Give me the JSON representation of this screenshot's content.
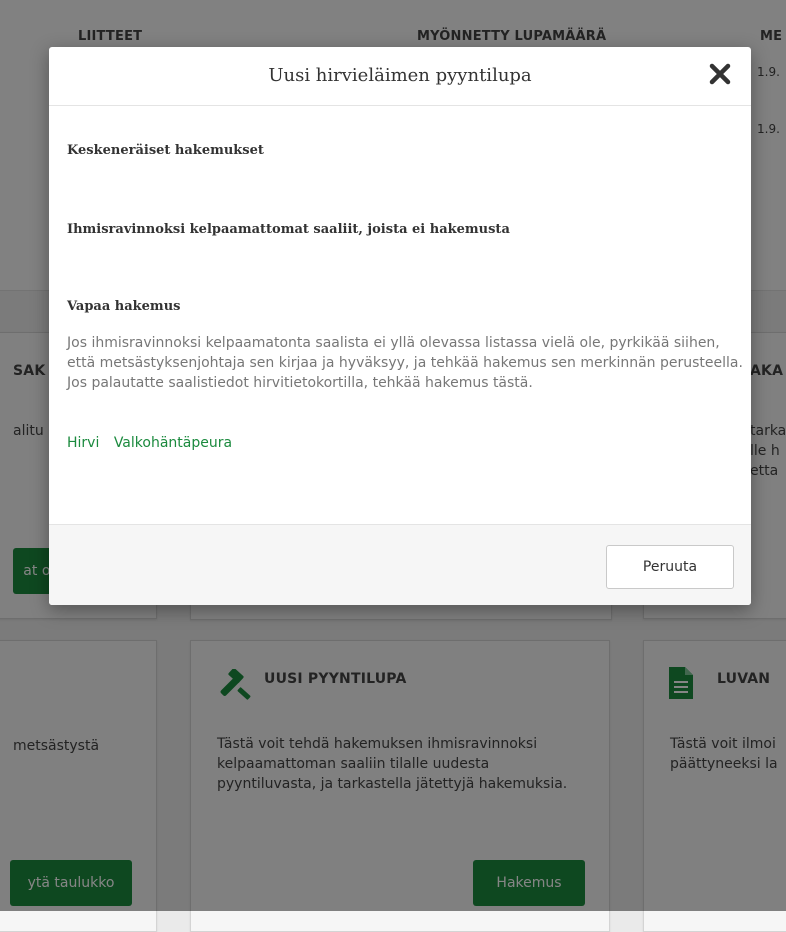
{
  "background": {
    "columns": {
      "attachments": "LIITTEET",
      "granted": "MYÖNNETTY LUPAMÄÄRÄ",
      "third_fragment": "ME"
    },
    "date_fragments": [
      "1.9.",
      "1.9."
    ],
    "left_card": {
      "title_fragment": "SAK",
      "desc_fragment": "alitu",
      "button_fragment": "at os"
    },
    "right_card_top": {
      "title_fragment": "AKA",
      "lines": [
        "tarka",
        "lle h",
        "etta"
      ]
    },
    "bottom_left_card": {
      "desc_fragment": "metsästystä",
      "button_fragment": "ytä taulukko"
    },
    "bottom_middle_card": {
      "title": "UUSI PYYNTILUPA",
      "desc": "Tästä voit tehdä hakemuksen ihmisravinnoksi kelpaamattoman saaliin tilalle uudesta pyyntiluvasta, ja tarkastella jätettyjä hakemuksia.",
      "button": "Hakemus"
    },
    "bottom_right_card": {
      "title_fragment": "LUVAN",
      "lines": [
        "Tästä voit ilmoi",
        "päättyneeksi la"
      ]
    }
  },
  "modal": {
    "title": "Uusi hirvieläimen pyyntilupa",
    "sections": {
      "incomplete": "Keskeneräiset hakemukset",
      "unfit_catch": "Ihmisravinnoksi kelpaamattomat saaliit, joista ei hakemusta",
      "free_application": "Vapaa hakemus"
    },
    "free_application_text": "Jos ihmisravinnoksi kelpaamatonta saalista ei yllä olevassa listassa vielä ole, pyrkikää siihen, että metsästyksenjohtaja sen kirjaa ja hyväksyy, ja tehkää hakemus sen merkinnän perusteella. Jos palautatte saalistiedot hirvitietokortilla, tehkää hakemus tästä.",
    "links": {
      "moose": "Hirvi",
      "white_tailed_deer": "Valkohäntäpeura"
    },
    "cancel": "Peruuta"
  },
  "colors": {
    "accent_green": "#1b8a3e",
    "overlay": "rgba(0,0,0,0.48)"
  }
}
